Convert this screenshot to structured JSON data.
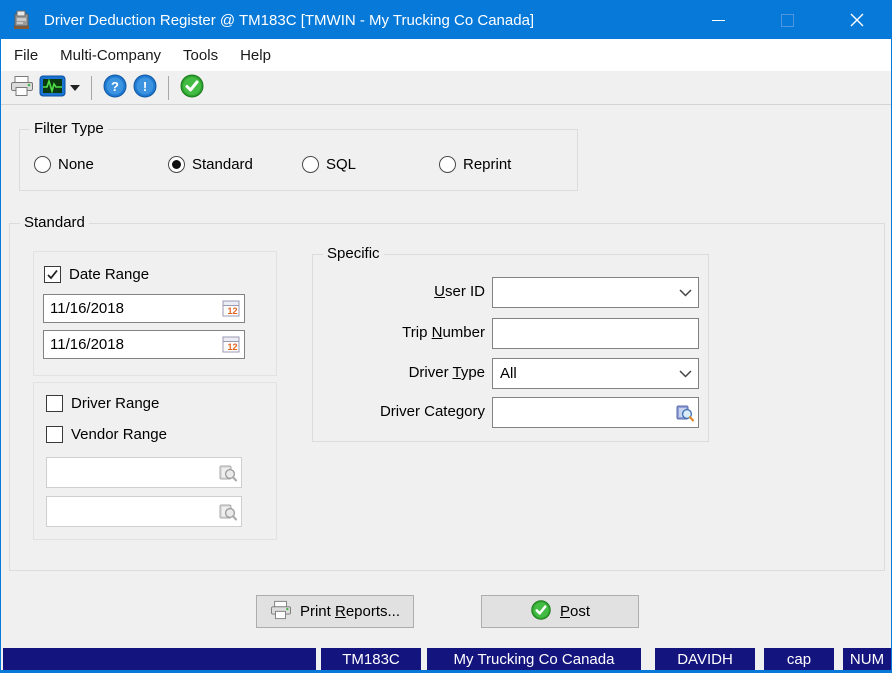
{
  "window": {
    "title": "Driver Deduction Register @ TM183C [TMWIN - My Trucking Co Canada]",
    "titlebar_color": "#0779d9"
  },
  "menu": {
    "items": [
      {
        "label": "File"
      },
      {
        "label": "Multi-Company"
      },
      {
        "label": "Tools"
      },
      {
        "label": "Help"
      }
    ]
  },
  "toolbar": {
    "icons": [
      "print-icon",
      "trace-monitor-icon",
      "dropdown-arrow-icon",
      "help-icon",
      "about-icon",
      "post-check-icon"
    ]
  },
  "filter_type": {
    "label": "Filter Type",
    "selected": "Standard",
    "options": [
      {
        "label": "None"
      },
      {
        "label": "Standard"
      },
      {
        "label": "SQL"
      },
      {
        "label": "Reprint"
      }
    ]
  },
  "standard": {
    "label": "Standard",
    "date_range": {
      "label": "Date Range",
      "checked": true,
      "from": "11/16/2018",
      "to": "11/16/2018"
    },
    "driver_range": {
      "label": "Driver Range",
      "checked": false,
      "value": ""
    },
    "vendor_range": {
      "label": "Vendor Range",
      "checked": false,
      "value": ""
    },
    "specific": {
      "label": "Specific",
      "user_id": {
        "label_pre": "",
        "label_key": "U",
        "label_post": "ser ID",
        "value": ""
      },
      "trip_number": {
        "label_pre": "Trip ",
        "label_key": "N",
        "label_post": "umber",
        "value": ""
      },
      "driver_type": {
        "label_pre": "Driver ",
        "label_key": "T",
        "label_post": "ype",
        "value": "All"
      },
      "driver_category": {
        "label_pre": "Driver Cate",
        "label_key": "g",
        "label_post": "ory",
        "value": ""
      }
    }
  },
  "buttons": {
    "print_reports": {
      "pre": "Print ",
      "key": "R",
      "post": "eports..."
    },
    "post": {
      "pre": "",
      "key": "P",
      "post": "ost"
    }
  },
  "status_bar": {
    "color": "#14147e",
    "segments": [
      "",
      "TM183C",
      "My Trucking Co Canada",
      "DAVIDH",
      "cap",
      "NUM"
    ]
  }
}
